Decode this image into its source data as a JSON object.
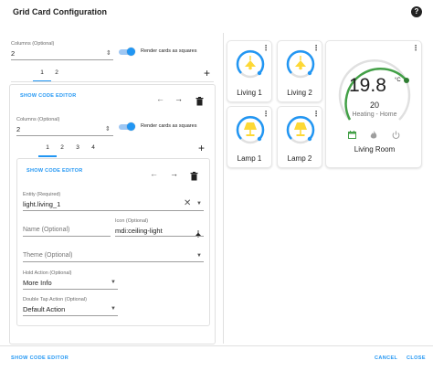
{
  "dialog": {
    "title": "Grid Card Configuration",
    "help_icon": "?"
  },
  "outer": {
    "columns_label": "Columns (Optional)",
    "columns_value": "2",
    "render_squares_label": "Render cards as squares",
    "tabs": [
      {
        "label": "1",
        "selected": true
      },
      {
        "label": "2",
        "selected": false
      }
    ],
    "add_symbol": "+"
  },
  "nested": {
    "show_code_editor": "SHOW CODE EDITOR",
    "columns_label": "Columns (Optional)",
    "columns_value": "2",
    "render_squares_label": "Render cards as squares",
    "tabs": [
      {
        "label": "1",
        "selected": true
      },
      {
        "label": "2",
        "selected": false
      },
      {
        "label": "3",
        "selected": false
      },
      {
        "label": "4",
        "selected": false
      }
    ],
    "add_symbol": "+"
  },
  "editor": {
    "show_code_editor": "SHOW CODE EDITOR",
    "entity_label": "Entity (Required)",
    "entity_value": "light.living_1",
    "name_placeholder": "Name (Optional)",
    "icon_label": "Icon (Optional)",
    "icon_value": "mdi:ceiling-light",
    "theme_placeholder": "Theme (Optional)",
    "hold_action_label": "Hold Action (Optional)",
    "hold_action_value": "More Info",
    "double_tap_label": "Double Tap Action (Optional)",
    "double_tap_value": "Default Action"
  },
  "preview": {
    "light_cards": [
      {
        "name": "Living 1",
        "icon": "ceiling-light-icon",
        "state": "on"
      },
      {
        "name": "Living 2",
        "icon": "ceiling-light-icon",
        "state": "on"
      },
      {
        "name": "Lamp 1",
        "icon": "lamp-icon",
        "state": "on"
      },
      {
        "name": "Lamp 2",
        "icon": "lamp-icon",
        "state": "on"
      }
    ],
    "thermostat": {
      "temperature": "19.8",
      "unit": "°C",
      "target": "20",
      "mode_text": "Heating - Home",
      "name": "Living Room"
    }
  },
  "footer": {
    "show_code_editor": "SHOW CODE EDITOR",
    "cancel": "CANCEL",
    "close": "CLOSE"
  },
  "colors": {
    "accent": "#2196f3",
    "light_on": "#fdd835",
    "thermo_arc": "#43a047",
    "thermo_track": "#e0e0e0"
  }
}
